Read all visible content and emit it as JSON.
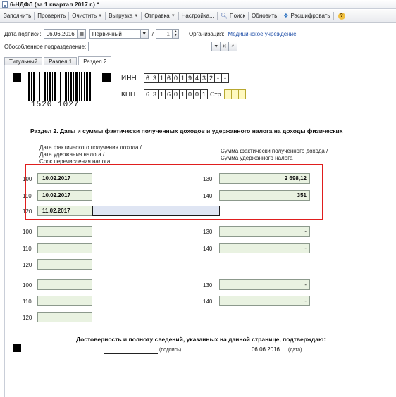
{
  "window": {
    "title": "6-НДФЛ (за 1 квартал 2017 г.) *"
  },
  "toolbar": {
    "fill": "Заполнить",
    "check": "Проверить",
    "clear": "Очистить",
    "export": "Выгрузка",
    "send": "Отправка",
    "settings": "Настройка...",
    "search": "Поиск",
    "refresh": "Обновить",
    "decode": "Расшифровать"
  },
  "header": {
    "sign_date_label": "Дата подписи:",
    "sign_date": "06.06.2016",
    "type_value": "Первичный",
    "slash": "/",
    "correction_no": "1",
    "org_label": "Организация:",
    "org_value": "Медицинское учреждение",
    "branch_label": "Обособленное подразделение:",
    "branch_value": ""
  },
  "tabs": [
    {
      "label": "Титульный"
    },
    {
      "label": "Раздел 1"
    },
    {
      "label": "Раздел 2"
    }
  ],
  "sheet": {
    "barcode_number": "1520 1027",
    "inn_label": "ИНН",
    "inn_cells": [
      "6",
      "3",
      "1",
      "6",
      "0",
      "1",
      "9",
      "4",
      "3",
      "2",
      "-",
      "-"
    ],
    "kpp_label": "КПП",
    "kpp_cells": [
      "6",
      "3",
      "1",
      "6",
      "0",
      "1",
      "0",
      "0",
      "1"
    ],
    "page_label": "Стр.",
    "page_cells": [
      "",
      "",
      ""
    ],
    "section_title": "Раздел 2.  Даты и суммы фактически полученных доходов и удержанного налога на доходы физических",
    "left_caption": [
      "Дата фактического получения дохода /",
      "Дата удержания налога /",
      "Срок перечисления налога"
    ],
    "right_caption": [
      "Сумма фактически полученного дохода /",
      "Сумма удержанного налога"
    ],
    "blocks": [
      {
        "r100": "100",
        "date100": "10.02.2017",
        "c130": "130",
        "v130": "2 698,12",
        "r110": "110",
        "date110": "10.02.2017",
        "c140": "140",
        "v140": "351",
        "r120": "120",
        "date120": "11.02.2017"
      },
      {
        "r100": "100",
        "date100": "",
        "c130": "130",
        "v130": "-",
        "r110": "110",
        "date110": "",
        "c140": "140",
        "v140": "-",
        "r120": "120",
        "date120": ""
      },
      {
        "r100": "100",
        "date100": "",
        "c130": "130",
        "v130": "-",
        "r110": "110",
        "date110": "",
        "c140": "140",
        "v140": "-",
        "r120": "120",
        "date120": ""
      }
    ],
    "confirm_text": "Достоверность и полноту сведений, указанных на данной странице, подтверждаю:",
    "signature_label": "(подпись)",
    "date_value": "06.06.2016",
    "date_label": "(дата)"
  },
  "colors": {
    "highlight": "#e01e1e",
    "field_bg": "#e9f2e1",
    "link": "#1f4fa8"
  }
}
